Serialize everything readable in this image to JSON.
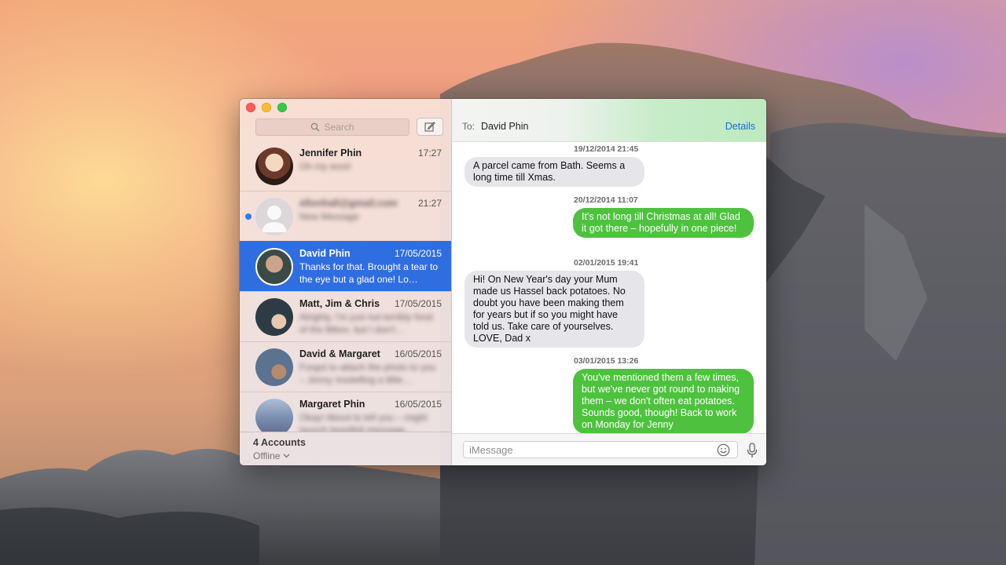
{
  "sidebar": {
    "search_placeholder": "Search",
    "conversations": [
      {
        "name": "Jennifer Phin",
        "time": "17:27",
        "preview": "Oh my word",
        "blurred": true
      },
      {
        "name": "ellonhall@gmail.com",
        "time": "21:27",
        "preview": "New Message",
        "blurred": true,
        "unread": true
      },
      {
        "name": "David Phin",
        "time": "17/05/2015",
        "preview": "Thanks for that. Brought a tear to the eye but a glad one! Lo…",
        "blurred": false,
        "selected": true
      },
      {
        "name": "Matt, Jim & Chris",
        "time": "17/05/2015",
        "preview": "Alrighty, I'm just not terribly fond of the Bikes, but I don't…",
        "blurred": true
      },
      {
        "name": "David & Margaret",
        "time": "16/05/2015",
        "preview": "Forgot to attach the photo to you – Jenny modelling a little…",
        "blurred": true
      },
      {
        "name": "Margaret Phin",
        "time": "16/05/2015",
        "preview": "Okay! About to tell you – might launch heartfelt message…",
        "blurred": true
      }
    ],
    "footer": {
      "accounts": "4 Accounts",
      "status": "Offline"
    }
  },
  "chat": {
    "to_label": "To:",
    "recipient": "David Phin",
    "details_label": "Details",
    "timestamps": [
      "19/12/2014 21:45",
      "20/12/2014 11:07",
      "02/01/2015 19:41",
      "03/01/2015 13:26"
    ],
    "messages": [
      {
        "direction": "in",
        "text": "A parcel came from Bath. Seems a long time till Xmas."
      },
      {
        "direction": "out",
        "text": "It's not long till Christmas at all! Glad it got there – hopefully in one piece!"
      },
      {
        "direction": "in",
        "text": "Hi! On New Year's day your Mum made us Hassel back potatoes. No  doubt you have been making them for years but if so you might have told us. Take care of yourselves. LOVE, Dad x"
      },
      {
        "direction": "out",
        "text": "You've mentioned them a few times, but we've never got round to making them – we don't often eat potatoes. Sounds good, though! Back to work on Monday for Jenny"
      }
    ],
    "input_placeholder": "iMessage"
  },
  "colors": {
    "selected_row": "#2f6ee0",
    "outgoing_bubble": "#4ec23e",
    "incoming_bubble": "#e5e5ea",
    "link": "#1b6bd6",
    "unread_dot": "#2e7cf6"
  },
  "icons": [
    "search-icon",
    "compose-icon",
    "chevron-down-icon",
    "emoji-icon",
    "microphone-icon"
  ]
}
